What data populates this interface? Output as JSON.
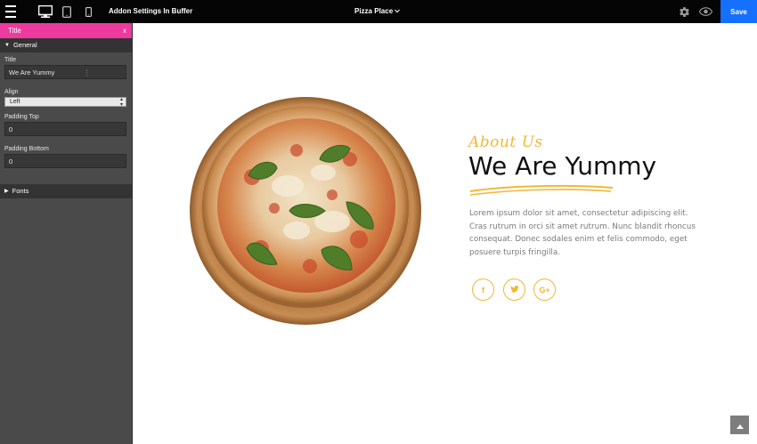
{
  "topbar": {
    "addon_title": "Addon Settings In Buffer",
    "page_name": "Pizza Place",
    "save_label": "Save"
  },
  "sidebar": {
    "header_title": "Title",
    "close_label": "x",
    "general_section": "General",
    "fields": {
      "title_label": "Title",
      "title_value": "We Are Yummy",
      "align_label": "Align",
      "align_value": "Left",
      "padding_top_label": "Padding Top",
      "padding_top_value": "0",
      "padding_bottom_label": "Padding Bottom",
      "padding_bottom_value": "0"
    },
    "fonts_section": "Fonts"
  },
  "content": {
    "about_label": "About Us",
    "headline": "We Are Yummy",
    "body": "Lorem ipsum dolor sit amet, consectetur adipiscing elit. Cras rutrum in orci sit amet rutrum. Nunc blandit rhoncus consequat. Donec sodales enim et felis commodo, eget posuere turpis fringilla.",
    "social": {
      "facebook_glyph": "f",
      "twitter_glyph": "t",
      "google_glyph": "G+"
    }
  },
  "colors": {
    "accent_gold": "#f1b737",
    "sidebar_header_pink": "#ee3a9e",
    "save_blue": "#1670ff",
    "topbar_black": "#050505"
  },
  "icons": [
    "hamburger-icon",
    "desktop-icon",
    "tablet-icon",
    "mobile-icon",
    "chevron-down-icon",
    "gear-icon",
    "eye-icon",
    "facebook-icon",
    "twitter-icon",
    "google-plus-icon",
    "arrow-up-icon"
  ]
}
